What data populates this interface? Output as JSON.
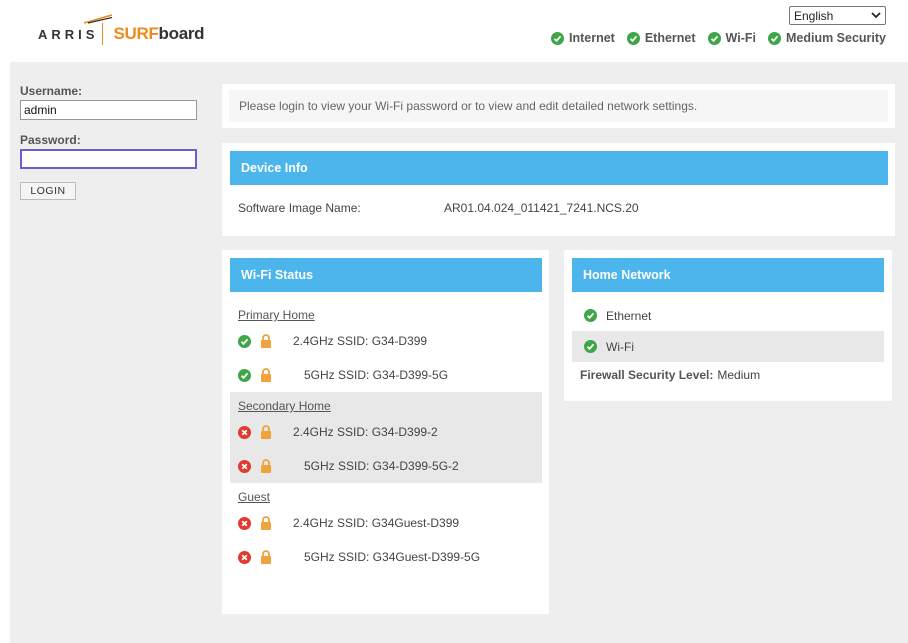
{
  "header": {
    "logo": {
      "arris": "ARRIS",
      "surf": "SURF",
      "board": "board"
    },
    "language": "English",
    "status": [
      {
        "label": "Internet",
        "state": "ok"
      },
      {
        "label": "Ethernet",
        "state": "ok"
      },
      {
        "label": "Wi-Fi",
        "state": "ok"
      },
      {
        "label": "Medium Security",
        "state": "ok"
      }
    ]
  },
  "login": {
    "username_label": "Username:",
    "username_value": "admin",
    "password_label": "Password:",
    "password_value": "",
    "login_button": "LOGIN"
  },
  "notice": "Please login to view your Wi-Fi password or to view and edit detailed network settings.",
  "device_info": {
    "title": "Device Info",
    "software_label": "Software Image Name:",
    "software_value": "AR01.04.024_011421_7241.NCS.20"
  },
  "wifi_status": {
    "title": "Wi-Fi Status",
    "primary": {
      "title": "Primary Home",
      "rows": [
        "2.4GHz SSID: G34-D399",
        "5GHz SSID: G34-D399-5G"
      ]
    },
    "secondary": {
      "title": "Secondary Home",
      "rows": [
        "2.4GHz SSID: G34-D399-2",
        "5GHz SSID: G34-D399-5G-2"
      ]
    },
    "guest": {
      "title": "Guest",
      "rows": [
        "2.4GHz SSID: G34Guest-D399",
        "5GHz SSID: G34Guest-D399-5G"
      ]
    }
  },
  "home_network": {
    "title": "Home Network",
    "items": [
      "Ethernet",
      "Wi-Fi"
    ],
    "firewall_label": "Firewall Security Level:",
    "firewall_value": "Medium"
  },
  "colors": {
    "accent_blue": "#4cb5ec",
    "ok_green": "#3ea648",
    "error_red": "#e23a2e",
    "brand_orange": "#f08a1c",
    "lock_orange": "#f0a33c"
  }
}
